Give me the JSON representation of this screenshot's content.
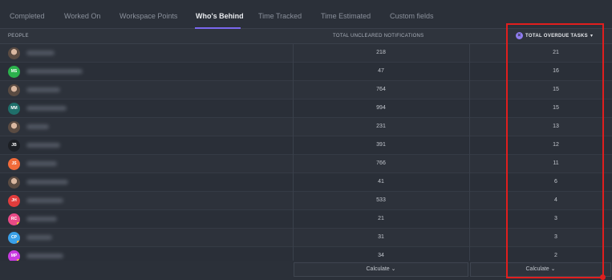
{
  "tabs": [
    {
      "label": "Completed",
      "active": false
    },
    {
      "label": "Worked On",
      "active": false
    },
    {
      "label": "Workspace Points",
      "active": false
    },
    {
      "label": "Who's Behind",
      "active": true
    },
    {
      "label": "Time Tracked",
      "active": false
    },
    {
      "label": "Time Estimated",
      "active": false
    },
    {
      "label": "Custom fields",
      "active": false
    }
  ],
  "table": {
    "headers": {
      "people": "PEOPLE",
      "notifications": "TOTAL UNCLEARED NOTIFICATIONS",
      "overdue": "TOTAL OVERDUE TASKS",
      "sort_indicator": "▾",
      "overdue_icon": "x-circle-icon"
    },
    "rows": [
      {
        "initials": "",
        "avatar_color": "#e9e4d6",
        "photo": true,
        "notifications": "218",
        "overdue": "21"
      },
      {
        "initials": "MS",
        "avatar_color": "#2bb24c",
        "photo": false,
        "notifications": "47",
        "overdue": "16"
      },
      {
        "initials": "",
        "avatar_color": "#3a4a6b",
        "photo": true,
        "notifications": "764",
        "overdue": "15"
      },
      {
        "initials": "MM",
        "avatar_color": "#1f6f6a",
        "photo": false,
        "notifications": "994",
        "overdue": "15"
      },
      {
        "initials": "",
        "avatar_color": "#6b6f78",
        "photo": true,
        "notifications": "231",
        "overdue": "13"
      },
      {
        "initials": "JB",
        "avatar_color": "#1c1f24",
        "photo": false,
        "notifications": "391",
        "overdue": "12"
      },
      {
        "initials": "JS",
        "avatar_color": "#f26b3a",
        "photo": false,
        "notifications": "766",
        "overdue": "11"
      },
      {
        "initials": "",
        "avatar_color": "#8a7a70",
        "photo": true,
        "notifications": "41",
        "overdue": "6"
      },
      {
        "initials": "JH",
        "avatar_color": "#e23c3c",
        "photo": false,
        "notifications": "533",
        "overdue": "4"
      },
      {
        "initials": "RC",
        "avatar_color": "#e84a86",
        "photo": false,
        "notifications": "21",
        "overdue": "3"
      },
      {
        "initials": "CP",
        "avatar_color": "#3aa0e8",
        "photo": false,
        "notifications": "31",
        "overdue": "3"
      },
      {
        "initials": "MP",
        "avatar_color": "#c83be0",
        "photo": false,
        "notifications": "34",
        "overdue": "2"
      }
    ],
    "calculate_label": "Calculate ⌄"
  },
  "highlight_color": "#e01e1e",
  "accent_color": "#7b68ee"
}
